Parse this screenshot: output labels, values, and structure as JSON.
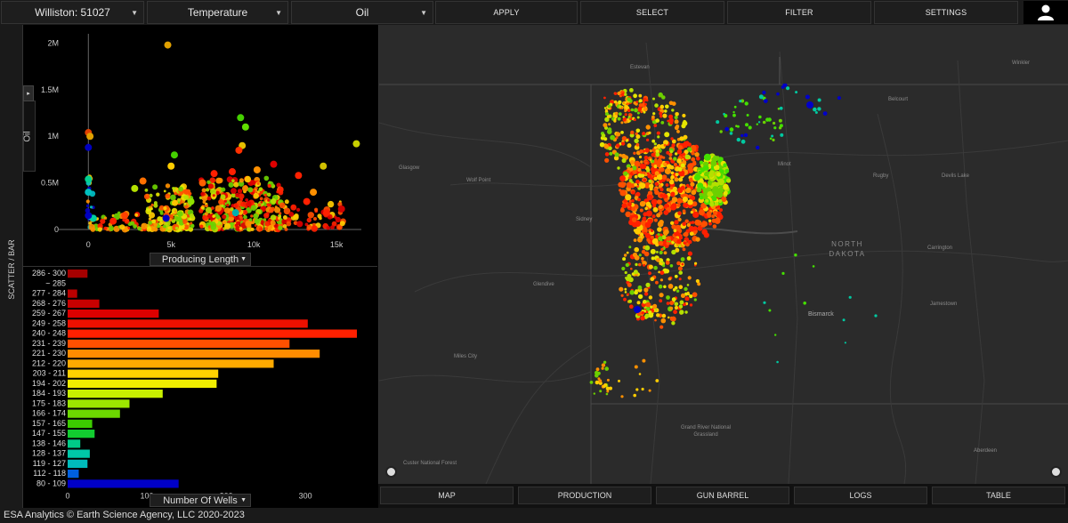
{
  "topbar": {
    "basin_select": "Williston: 51027",
    "color_select": "Temperature",
    "metric_select": "Oil",
    "buttons": [
      "APPLY",
      "SELECT",
      "FILTER",
      "SETTINGS"
    ]
  },
  "side_label": "SCATTER / BAR",
  "scatter": {
    "y_label": "Oil",
    "x_select": "Producing Length",
    "y_ticks": [
      "2M",
      "1.5M",
      "1M",
      "0.5M",
      "0"
    ],
    "x_ticks": [
      "0",
      "5k",
      "10k",
      "15k"
    ]
  },
  "bar": {
    "x_select": "Number Of Wells",
    "x_ticks": [
      "0",
      "100",
      "200",
      "300"
    ]
  },
  "chart_data": [
    {
      "type": "scatter",
      "title": "",
      "xlabel": "Producing Length",
      "ylabel": "Oil",
      "xlim": [
        -500,
        16500
      ],
      "ylim": [
        0,
        2100000
      ],
      "x_ticks": [
        "0",
        "5k",
        "10k",
        "15k"
      ],
      "y_ticks": [
        "0",
        "0.5M",
        "1M",
        "1.5M",
        "2M"
      ],
      "points": [
        {
          "x": 4800,
          "y": 1980000,
          "c": "#e0a000"
        },
        {
          "x": 16200,
          "y": 920000,
          "c": "#c8d000"
        },
        {
          "x": 9200,
          "y": 1200000,
          "c": "#44d000"
        },
        {
          "x": 9300,
          "y": 900000,
          "c": "#e6c000"
        },
        {
          "x": 9500,
          "y": 1100000,
          "c": "#60e000"
        },
        {
          "x": 0,
          "y": 1040000,
          "c": "#e04000"
        },
        {
          "x": 100,
          "y": 1000000,
          "c": "#e0a000"
        },
        {
          "x": 0,
          "y": 880000,
          "c": "#0000c0"
        },
        {
          "x": 0,
          "y": 540000,
          "c": "#00d090"
        },
        {
          "x": 0,
          "y": 400000,
          "c": "#00c0c0"
        },
        {
          "x": 5200,
          "y": 800000,
          "c": "#44d000"
        },
        {
          "x": 5000,
          "y": 680000,
          "c": "#ffcc00"
        },
        {
          "x": 9100,
          "y": 850000,
          "c": "#ff3000"
        },
        {
          "x": 14200,
          "y": 680000,
          "c": "#d0c000"
        },
        {
          "x": 13600,
          "y": 400000,
          "c": "#ff9000"
        },
        {
          "x": 12700,
          "y": 580000,
          "c": "#ff2000"
        },
        {
          "x": 11200,
          "y": 700000,
          "c": "#e00000"
        },
        {
          "x": 7600,
          "y": 600000,
          "c": "#ff2000"
        },
        {
          "x": 3300,
          "y": 520000,
          "c": "#ff7000"
        },
        {
          "x": 2800,
          "y": 440000,
          "c": "#b4e000"
        },
        {
          "x": 6900,
          "y": 500000,
          "c": "#ff6000"
        },
        {
          "x": 8700,
          "y": 620000,
          "c": "#ff2000"
        },
        {
          "x": 10200,
          "y": 640000,
          "c": "#ff9000"
        },
        {
          "x": 13200,
          "y": 300000,
          "c": "#ff2000"
        },
        {
          "x": 14400,
          "y": 180000,
          "c": "#ff2000"
        },
        {
          "x": 15300,
          "y": 220000,
          "c": "#d00000"
        },
        {
          "x": 6200,
          "y": 300000,
          "c": "#90e000"
        },
        {
          "x": 1500,
          "y": 90000,
          "c": "#ff2000"
        },
        {
          "x": 2200,
          "y": 150000,
          "c": "#ff4000"
        },
        {
          "x": 8900,
          "y": 180000,
          "c": "#00b0b0"
        },
        {
          "x": 4700,
          "y": 120000,
          "c": "#0000c0"
        },
        {
          "x": 300,
          "y": 120000,
          "c": "#00d0a0"
        },
        {
          "x": 0,
          "y": 150000,
          "c": "#0000c0"
        }
      ],
      "clusters": [
        {
          "x_range": [
            3500,
            6300
          ],
          "y_range": [
            0,
            480000
          ],
          "colors": [
            "#ffcc00",
            "#b4e000",
            "#ff9000",
            "#6cd000",
            "#e6e600",
            "#ff5000"
          ],
          "count": 170
        },
        {
          "x_range": [
            6800,
            11700
          ],
          "y_range": [
            0,
            560000
          ],
          "colors": [
            "#ff2000",
            "#ff5000",
            "#b4e000",
            "#ffcc00",
            "#6cd000",
            "#e00000",
            "#ff9000"
          ],
          "count": 330
        },
        {
          "x_range": [
            400,
            3500
          ],
          "y_range": [
            0,
            180000
          ],
          "colors": [
            "#ff2000",
            "#ffcc00",
            "#6cd000",
            "#ff9000"
          ],
          "count": 45
        },
        {
          "x_range": [
            11700,
            15500
          ],
          "y_range": [
            0,
            300000
          ],
          "colors": [
            "#ff2000",
            "#ff5000",
            "#ffcc00",
            "#e00000"
          ],
          "count": 55
        },
        {
          "x_range": [
            -100,
            300
          ],
          "y_range": [
            0,
            600000
          ],
          "colors": [
            "#ff9000",
            "#00c0c0",
            "#0000c0",
            "#ffcc00"
          ],
          "count": 25
        }
      ]
    },
    {
      "type": "bar",
      "orientation": "horizontal",
      "xlabel": "Number Of Wells",
      "xlim": [
        0,
        365
      ],
      "x_ticks": [
        "0",
        "100",
        "200",
        "300"
      ],
      "categories": [
        "286 - 300",
        "~ 285",
        "277 - 284",
        "268 - 276",
        "259 - 267",
        "249 - 258",
        "240 - 248",
        "231 - 239",
        "221 - 230",
        "212 - 220",
        "203 - 211",
        "194 - 202",
        "184 - 193",
        "175 - 183",
        "166 - 174",
        "157 - 165",
        "147 - 155",
        "138 - 146",
        "128 - 137",
        "119 - 127",
        "112 - 118",
        "80 - 109"
      ],
      "values": [
        25,
        0,
        12,
        40,
        115,
        303,
        365,
        280,
        318,
        260,
        190,
        188,
        120,
        78,
        66,
        31,
        34,
        16,
        28,
        25,
        14,
        140
      ],
      "colors": [
        "#a50000",
        "#b00000",
        "#bb0000",
        "#c80000",
        "#dd0000",
        "#ee1000",
        "#ff2000",
        "#ff5000",
        "#ff8c00",
        "#ffaa00",
        "#ffd200",
        "#f0ee00",
        "#c8f000",
        "#9ce600",
        "#6cd800",
        "#3ccc00",
        "#12cc30",
        "#00cc88",
        "#00c8a8",
        "#00bcbc",
        "#0060e0",
        "#0000c8"
      ]
    }
  ],
  "map": {
    "places": [
      {
        "name": "Estevan",
        "c": "place-estevan"
      },
      {
        "name": "Winkler",
        "c": "place-winkler"
      },
      {
        "name": "Belcourt",
        "c": "place-belcourt"
      },
      {
        "name": "Glasgow",
        "c": "place-glasgow"
      },
      {
        "name": "Wolf Point",
        "c": "place-wolfpoint"
      },
      {
        "name": "Sidney",
        "c": "place-sidney"
      },
      {
        "name": "Minot",
        "c": "place-minot"
      },
      {
        "name": "Rugby",
        "c": "place-rugby"
      },
      {
        "name": "Devils Lake",
        "c": "place-devilslake"
      },
      {
        "name": "Carrington",
        "c": "place-carrington"
      },
      {
        "name": "Glendive",
        "c": "place-glendive"
      },
      {
        "name": "Bismarck",
        "c": "place-bismarck"
      },
      {
        "name": "Jamestown",
        "c": "place-jamestown"
      },
      {
        "name": "Miles City",
        "c": "place-milescity"
      },
      {
        "name": "Grand River National Grassland",
        "c": "place-grandriver"
      },
      {
        "name": "Custer National Forest",
        "c": "place-custer"
      },
      {
        "name": "Aberdeen",
        "c": "place-aberdeen"
      }
    ],
    "state_label": "NORTH DAKOTA",
    "well_colors": [
      "#ff2000",
      "#ff5000",
      "#ff9000",
      "#ffcc00",
      "#e6e600",
      "#b4e000",
      "#6cd000",
      "#44e000",
      "#00c8a0",
      "#0000c8"
    ]
  },
  "bottom_tabs": [
    "MAP",
    "PRODUCTION",
    "GUN BARREL",
    "LOGS",
    "TABLE"
  ],
  "footer": "ESA Analytics © Earth Science Agency, LLC 2020-2023"
}
